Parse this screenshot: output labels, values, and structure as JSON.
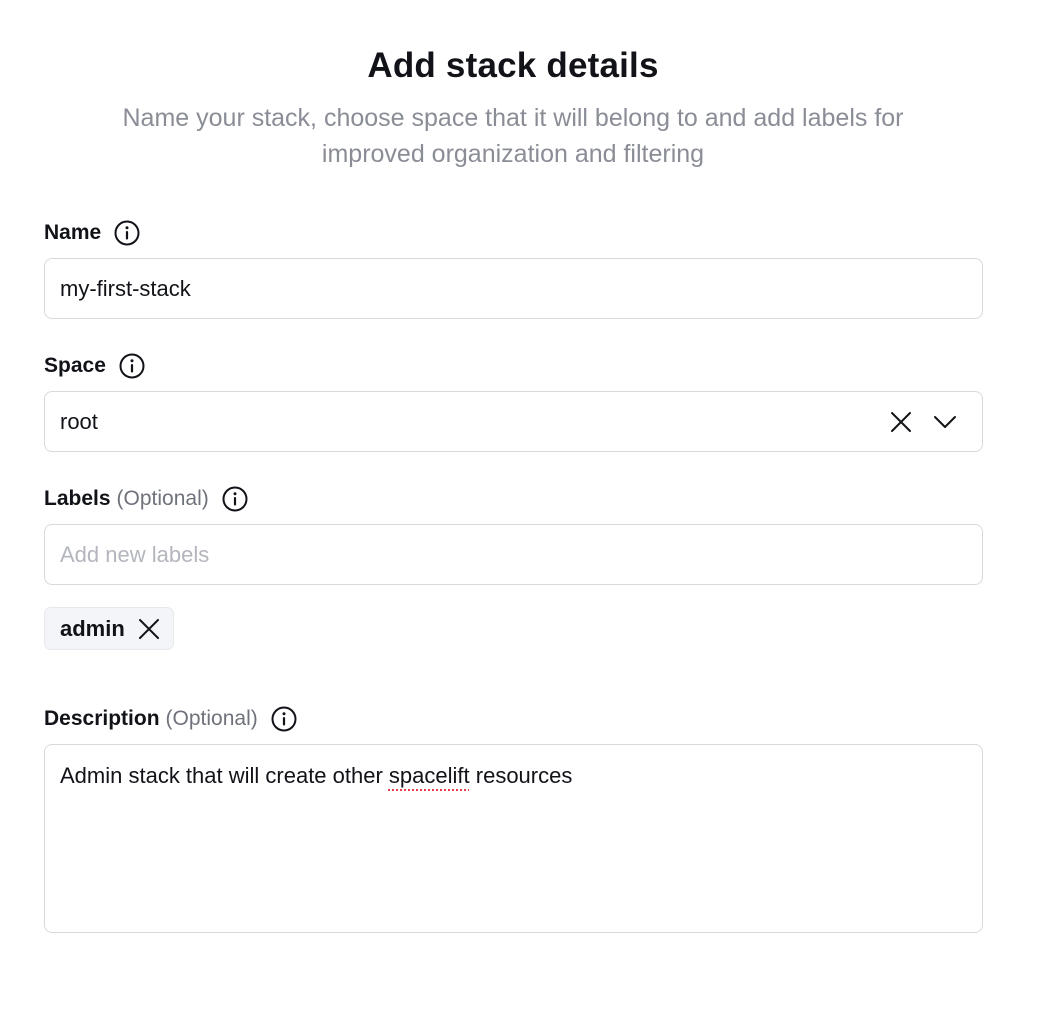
{
  "header": {
    "title": "Add stack details",
    "subtitle": "Name your stack, choose space that it will belong to and add labels for improved organization and filtering"
  },
  "fields": {
    "name": {
      "label": "Name",
      "value": "my-first-stack"
    },
    "space": {
      "label": "Space",
      "value": "root"
    },
    "labels": {
      "label": "Labels",
      "optional": "(Optional)",
      "placeholder": "Add new labels",
      "tags": [
        "admin"
      ]
    },
    "description": {
      "label": "Description",
      "optional": "(Optional)",
      "value_before": "Admin stack that will create other ",
      "value_misspelled": "spacelift",
      "value_after": " resources"
    }
  },
  "icons": {
    "info": "info-circle-icon",
    "clear": "close-icon",
    "dropdown": "chevron-down-icon"
  },
  "colors": {
    "text": "#111318",
    "muted": "#8a8d96",
    "border": "#d7d9de",
    "tag_bg": "#f4f5f8",
    "spellcheck": "#e0434b"
  }
}
